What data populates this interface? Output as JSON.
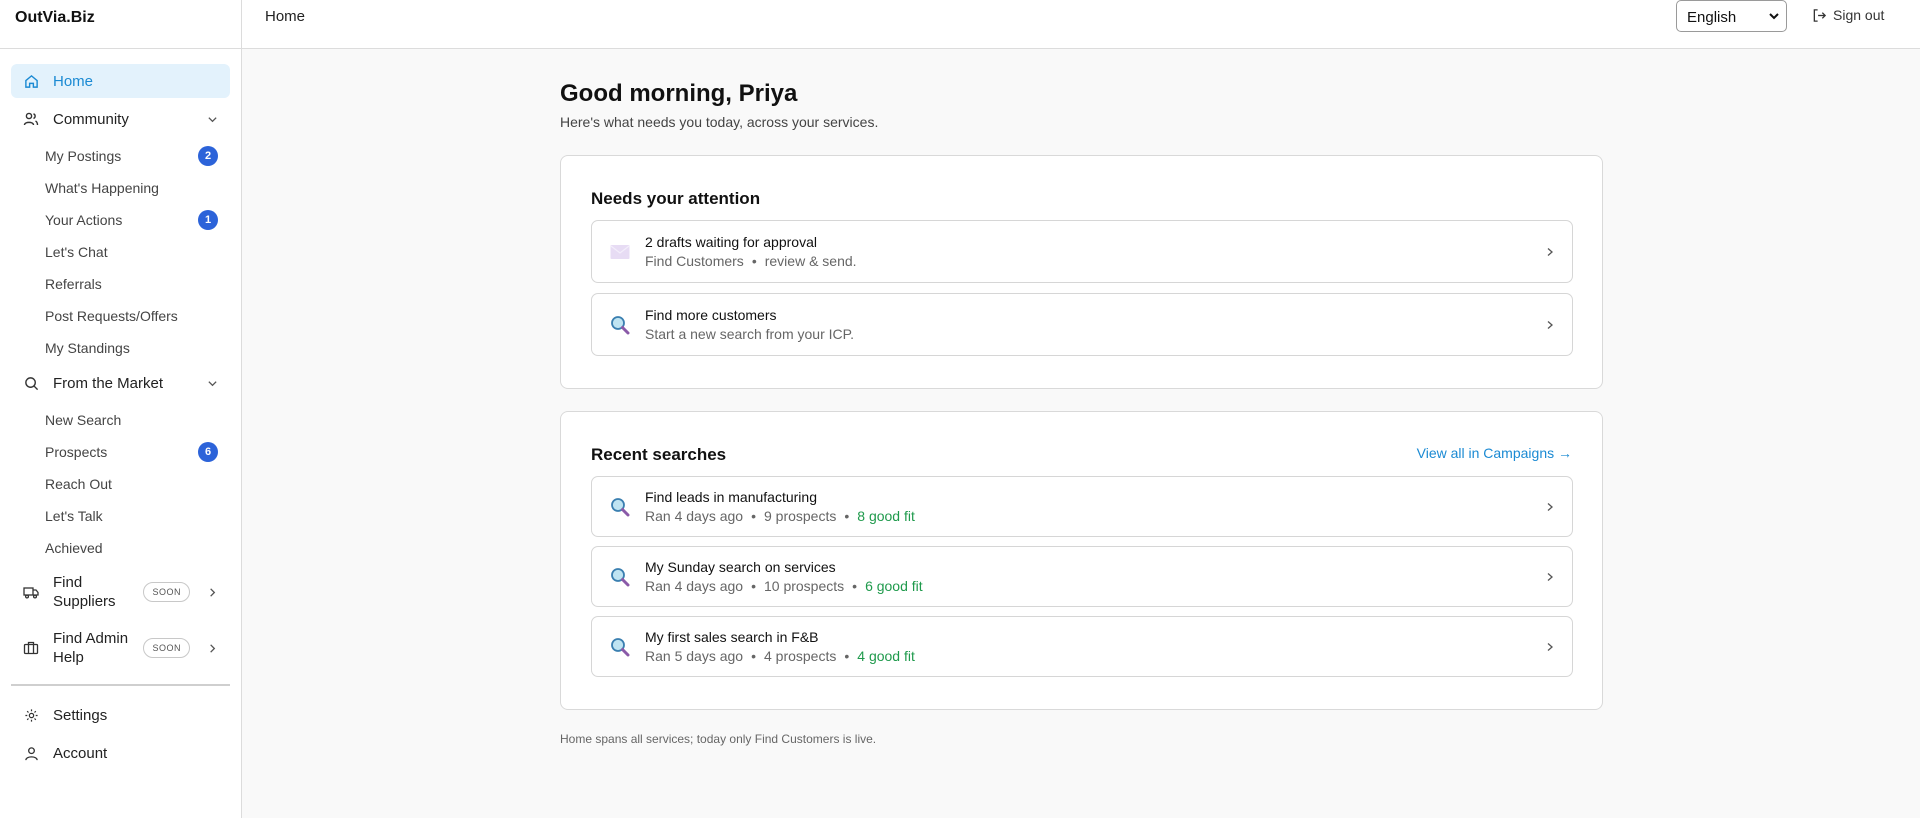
{
  "app": {
    "brand": "OutVia.Biz"
  },
  "topbar": {
    "breadcrumb": "Home",
    "language": "English",
    "sign_out": "Sign out"
  },
  "sidebar": {
    "home": "Home",
    "community": {
      "label": "Community",
      "items": [
        {
          "label": "My Postings",
          "badge": "2"
        },
        {
          "label": "What's Happening"
        },
        {
          "label": "Your Actions",
          "badge": "1"
        },
        {
          "label": "Let's Chat"
        },
        {
          "label": "Referrals"
        },
        {
          "label": "Post Requests/Offers"
        },
        {
          "label": "My Standings"
        }
      ]
    },
    "market": {
      "label": "From the Market",
      "items": [
        {
          "label": "New Search"
        },
        {
          "label": "Prospects",
          "badge": "6"
        },
        {
          "label": "Reach Out"
        },
        {
          "label": "Let's Talk"
        },
        {
          "label": "Achieved"
        }
      ]
    },
    "find_suppliers": {
      "line1": "Find",
      "line2": "Suppliers",
      "tag": "SOON"
    },
    "find_admin": {
      "line1": "Find Admin",
      "line2": "Help",
      "tag": "SOON"
    },
    "settings": "Settings",
    "account": "Account"
  },
  "main": {
    "greeting": "Good morning, Priya",
    "subtitle": "Here's what needs you today, across your services.",
    "attention": {
      "title": "Needs your attention",
      "items": [
        {
          "title": "2 drafts waiting for approval",
          "sub1": "Find Customers",
          "sub2": "review & send.",
          "icon": "envelope-icon"
        },
        {
          "title": "Find more customers",
          "sub1": "Start a new search from your ICP.",
          "icon": "magnifier-icon"
        }
      ]
    },
    "recent": {
      "title": "Recent searches",
      "view_all": "View all in Campaigns →",
      "items": [
        {
          "title": "Find leads in manufacturing",
          "ran": "Ran 4 days ago",
          "prospects": "9 prospects",
          "fit": "8 good fit"
        },
        {
          "title": "My Sunday search on services",
          "ran": "Ran 4 days ago",
          "prospects": "10 prospects",
          "fit": "6 good fit"
        },
        {
          "title": "My first sales search in F&B",
          "ran": "Ran 5 days ago",
          "prospects": "4 prospects",
          "fit": "4 good fit"
        }
      ]
    },
    "footnote": "Home spans all services; today only Find Customers is live.",
    "colors": {
      "accent": "#1b8ad3",
      "badge": "#2c63d9",
      "good": "#1f9a4c",
      "active_bg": "#e3f2fc"
    }
  }
}
